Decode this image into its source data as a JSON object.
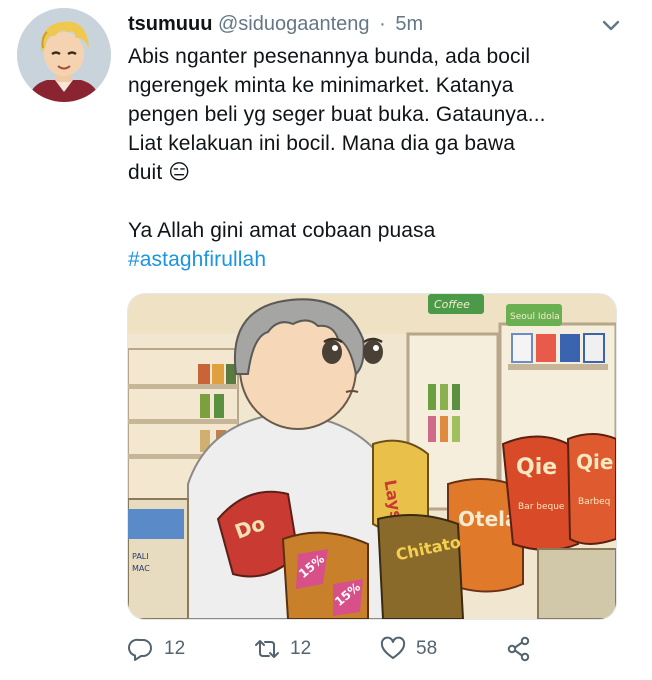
{
  "tweet": {
    "display_name": "tsumuuu",
    "handle": "@siduogaanteng",
    "separator": "·",
    "time": "5m",
    "text_lines": [
      "Abis nganter pesenannya bunda, ada bocil",
      "ngerengek minta ke minimarket. Katanya",
      "pengen beli yg seger buat buka. Gataunya...",
      "Liat kelakuan ini bocil. Mana dia ga bawa",
      "duit"
    ],
    "emoji": "😑",
    "line2": "Ya Allah gini amat cobaan puasa",
    "hashtag": "#astaghfirullah"
  },
  "media": {
    "snack_labels": [
      "Coffee",
      "Seoul Idola",
      "Qie",
      "Qie",
      "Do",
      "Lays",
      "Otela",
      "Chitato",
      "15%",
      "15%",
      "PALI",
      "MAC",
      "Bar beque",
      "Barbeq"
    ]
  },
  "actions": {
    "reply_count": "12",
    "retweet_count": "12",
    "like_count": "58"
  },
  "colors": {
    "accent": "#1b95e0",
    "text": "#0f1419",
    "secondary": "#657786"
  }
}
